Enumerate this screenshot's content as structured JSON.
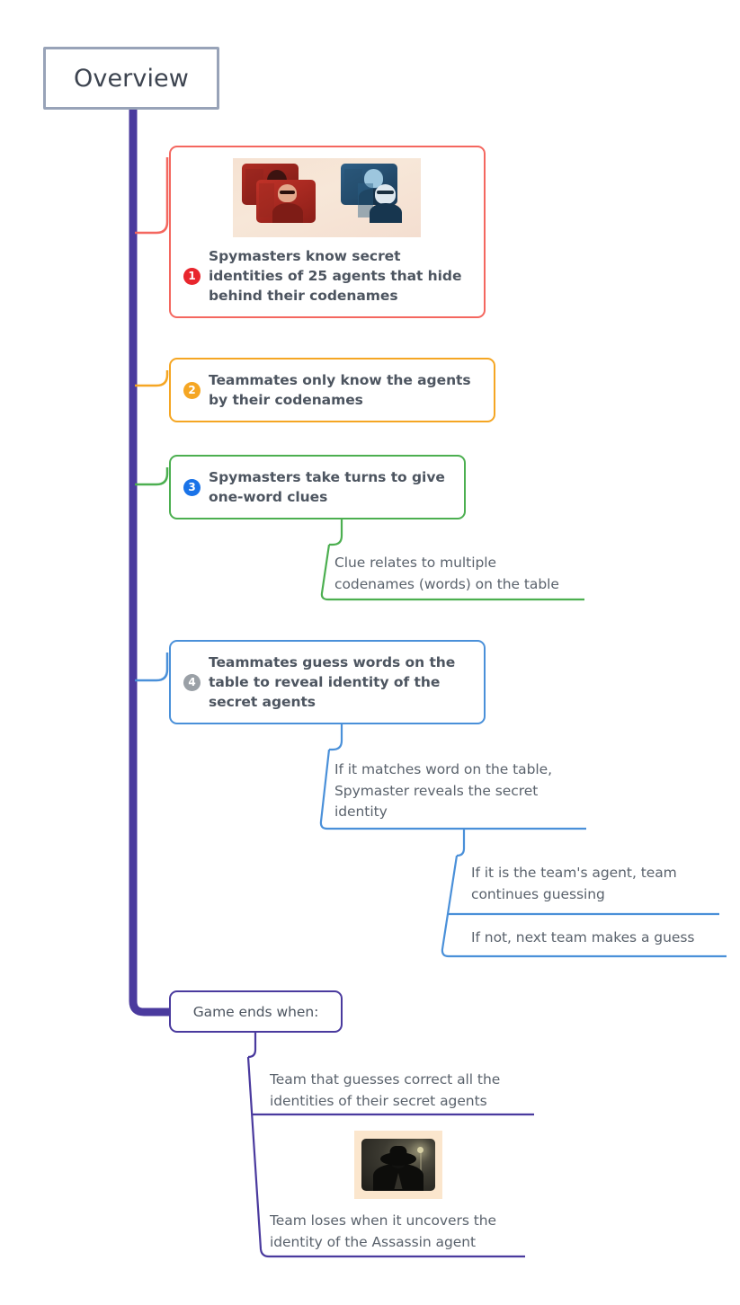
{
  "diagram": {
    "type": "mind-map",
    "title": "Overview",
    "background": "#ffffff"
  },
  "colors": {
    "trunk": "#4a3a9e",
    "root_border": "#98a3b8",
    "root_text": "#3d4450",
    "node1": "#f4675f",
    "node2": "#f5a623",
    "node3": "#4caf50",
    "node4": "#4a90d9",
    "purple": "#4a3a9e",
    "badge1": "#e8262d",
    "badge2": "#f5a623",
    "badge3": "#1a73e8",
    "badge4": "#9aa0a6",
    "node_text": "#4d5560",
    "leaf_text": "#5a626c"
  },
  "root": {
    "label": "Overview"
  },
  "branches": [
    {
      "number": "1",
      "text": "Spymasters know secret identities of 25 agents that hide behind their codenames",
      "color": "#f4675f",
      "badge_color": "#e8262d",
      "has_image": true,
      "image": {
        "name": "spy-team-cards-image",
        "alt": "Red team and blue team agent cards"
      },
      "children": []
    },
    {
      "number": "2",
      "text": "Teammates only know the agents by their codenames",
      "color": "#f5a623",
      "badge_color": "#f5a623",
      "has_image": false,
      "children": []
    },
    {
      "number": "3",
      "text": "Spymasters take turns to give one-word clues",
      "color": "#4caf50",
      "badge_color": "#1a73e8",
      "has_image": false,
      "children": [
        {
          "text": "Clue relates to multiple\ncodenames (words) on the table"
        }
      ]
    },
    {
      "number": "4",
      "text": "Teammates guess words on the table to reveal identity of the secret agents",
      "color": "#4a90d9",
      "badge_color": "#9aa0a6",
      "has_image": false,
      "children": [
        {
          "text": "If it matches word on the table,\nSpymaster reveals the secret\nidentity",
          "children": [
            {
              "text": "If it is the team's agent, team\ncontinues guessing"
            },
            {
              "text": "If not, next team makes a guess"
            }
          ]
        }
      ]
    }
  ],
  "ending": {
    "label": "Game ends when:",
    "color": "#4a3a9e",
    "children": [
      {
        "text": "Team that guesses correct all the\nidentities of their secret agents"
      },
      {
        "text": "Team loses when it uncovers the\nidentity of the Assassin agent"
      }
    ],
    "image": {
      "name": "assassin-card-image",
      "alt": "Assassin agent card"
    }
  }
}
